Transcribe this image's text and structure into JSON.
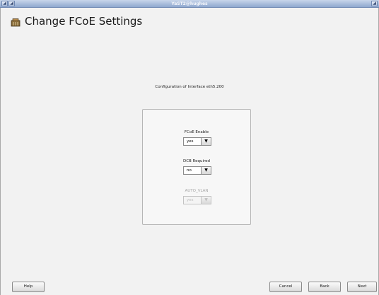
{
  "window": {
    "title": "YaST2@hughes"
  },
  "header": {
    "title": "Change FCoE Settings",
    "icon": "fcoe-settings-icon"
  },
  "main": {
    "config_label": "Configuration of Interface eth5.200",
    "fields": [
      {
        "label": "FCoE Enable",
        "value": "yes",
        "enabled": true
      },
      {
        "label": "DCB Required",
        "value": "no",
        "enabled": true
      },
      {
        "label": "AUTO_VLAN",
        "value": "yes",
        "enabled": false
      }
    ]
  },
  "buttons": {
    "help": "Help",
    "cancel": "Cancel",
    "back": "Back",
    "next": "Next"
  }
}
